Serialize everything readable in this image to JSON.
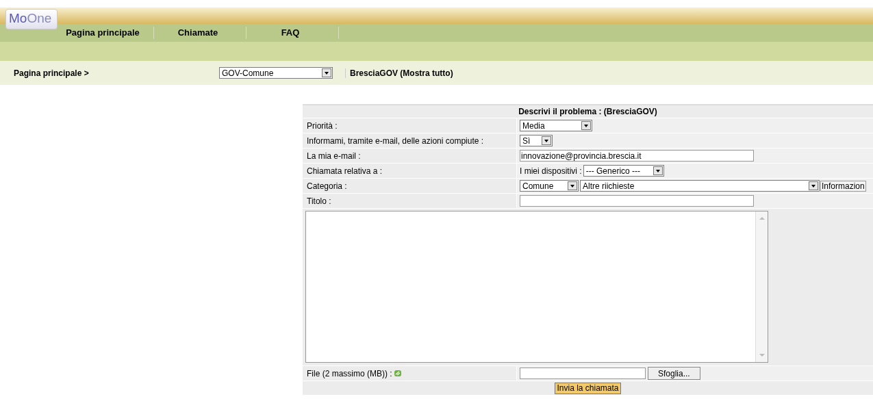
{
  "logo": {
    "text_a": "Mo",
    "text_b": "One"
  },
  "nav": [
    {
      "label": "Pagina principale"
    },
    {
      "label": "Chiamate"
    },
    {
      "label": "FAQ"
    }
  ],
  "breadcrumb": "Pagina principale >",
  "group_select": {
    "value": "GOV-Comune"
  },
  "context_title": "BresciaGOV (Mostra tutto)",
  "form": {
    "title": "Descrivi il problema :  (BresciaGOV)",
    "priority": {
      "label": "Priorità :",
      "value": "Media"
    },
    "notify": {
      "label": "Informami, tramite e-mail, delle azioni compiute :",
      "value": "Sì"
    },
    "email": {
      "label": "La mia e-mail :",
      "value": "innovazione@provincia.brescia.it"
    },
    "related": {
      "label": "Chiamata relativa a :",
      "prefix": "I miei dispositivi :",
      "value": "--- Generico ---"
    },
    "category": {
      "label": "Categoria :",
      "value": "Comune",
      "subvalue": "Altre riichieste",
      "info": "Informazion"
    },
    "title_field": {
      "label": "Titolo :"
    },
    "file": {
      "label": "File (2 massimo (MB)) :",
      "browse": "Sfoglia..."
    },
    "submit": "Invia la chiamata"
  }
}
